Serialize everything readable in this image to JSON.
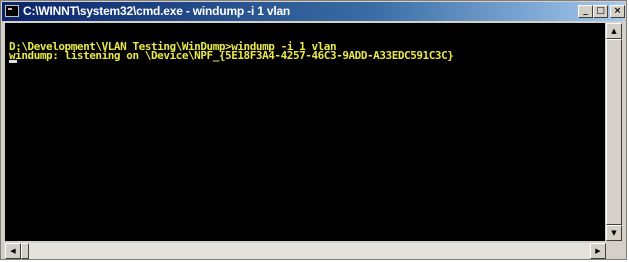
{
  "window": {
    "title": "C:\\WINNT\\system32\\cmd.exe - windump -i 1 vlan",
    "icon": "cmd-icon",
    "controls": {
      "minimize_glyph": "_",
      "maximize_glyph": "□",
      "close_glyph": "×"
    }
  },
  "console": {
    "lines": [
      "D:\\Development\\VLAN Testing\\WinDump>windump -i 1 vlan",
      "windump: listening on \\Device\\NPF_{5E18F3A4-4257-46C3-9ADD-A33EDC591C3C}"
    ],
    "text_color": "#e8e84a",
    "background": "#000000"
  },
  "scrollbars": {
    "up_arrow": "▲",
    "down_arrow": "▼",
    "left_arrow": "◀",
    "right_arrow": "▶"
  }
}
